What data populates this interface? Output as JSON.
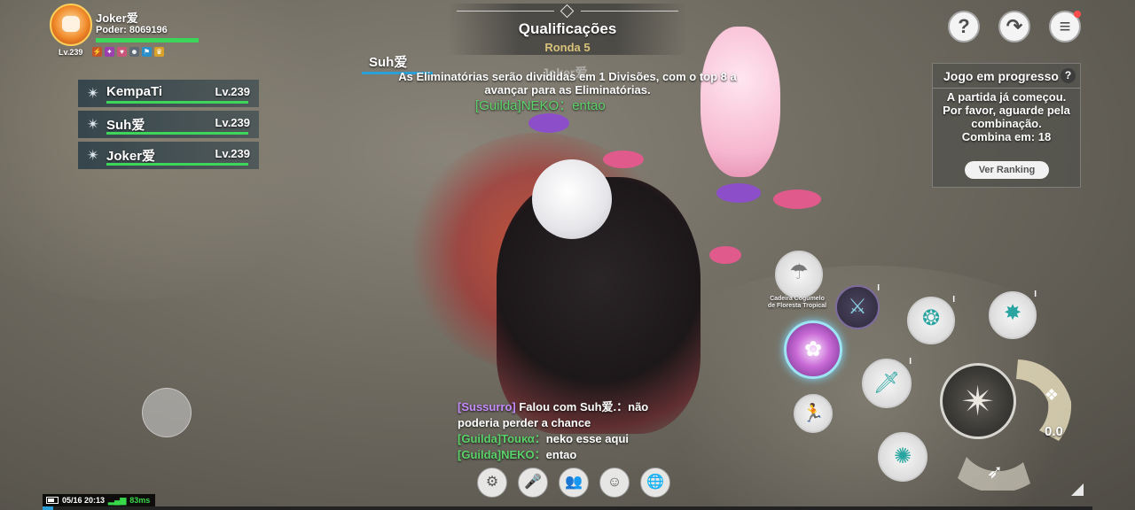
{
  "player": {
    "name": "Joker爱",
    "power_label": "Poder: 8069196",
    "level": "Lv.239",
    "buffs": [
      "⚡",
      "✦",
      "♥",
      "☻",
      "⚑",
      "♛"
    ]
  },
  "party": [
    {
      "name": "KempaTi",
      "level": "Lv.239"
    },
    {
      "name": "Suh爱",
      "level": "Lv.239"
    },
    {
      "name": "Joker爱",
      "level": "Lv.239"
    }
  ],
  "banner": {
    "title": "Qualificações",
    "round": "Ronda 5"
  },
  "notice": "As Eliminatórias serão divididas em 1 Divisões, com o top 8 a avançar para as Eliminatórias.",
  "nameplates": {
    "suh": "Suh爱",
    "joker": "Joker爱"
  },
  "floating_chat": "[Guilda]NEKO：entao",
  "top_buttons": {
    "help": "?",
    "share": "↷",
    "menu": "≡"
  },
  "progress_panel": {
    "title": "Jogo em progresso",
    "help": "?",
    "body_lines": [
      "A partida já começou.",
      "Por favor, aguarde pela",
      "combinação.",
      "Combina em: 18"
    ],
    "button": "Ver Ranking"
  },
  "skills": {
    "chair_label_lines": [
      "Cadeira Cogumelo",
      "de Floresta Tropical"
    ],
    "gauge_value": "0.0"
  },
  "chat": [
    {
      "channel": "[Sussurro]",
      "text": " Falou com Suh爱.：não",
      "type": "whisper"
    },
    {
      "channel": "",
      "text": "poderia perder a chance",
      "type": "plain"
    },
    {
      "channel": "[Guilda]Touκα：",
      "text": "neko esse aqui",
      "type": "guild"
    },
    {
      "channel": "[Guilda]NEKO：",
      "text": "entao",
      "type": "guild"
    }
  ],
  "bottom_bar": [
    "⚙",
    "🎤",
    "👥",
    "☺",
    "🌐"
  ],
  "status": {
    "datetime": "05/16 20:13",
    "ping": "83ms"
  },
  "colors": {
    "hp_green": "#3cd65a",
    "guild_green": "#5bd36a",
    "whisper_purple": "#c58cff",
    "accent_blue": "#2a9fd8"
  }
}
